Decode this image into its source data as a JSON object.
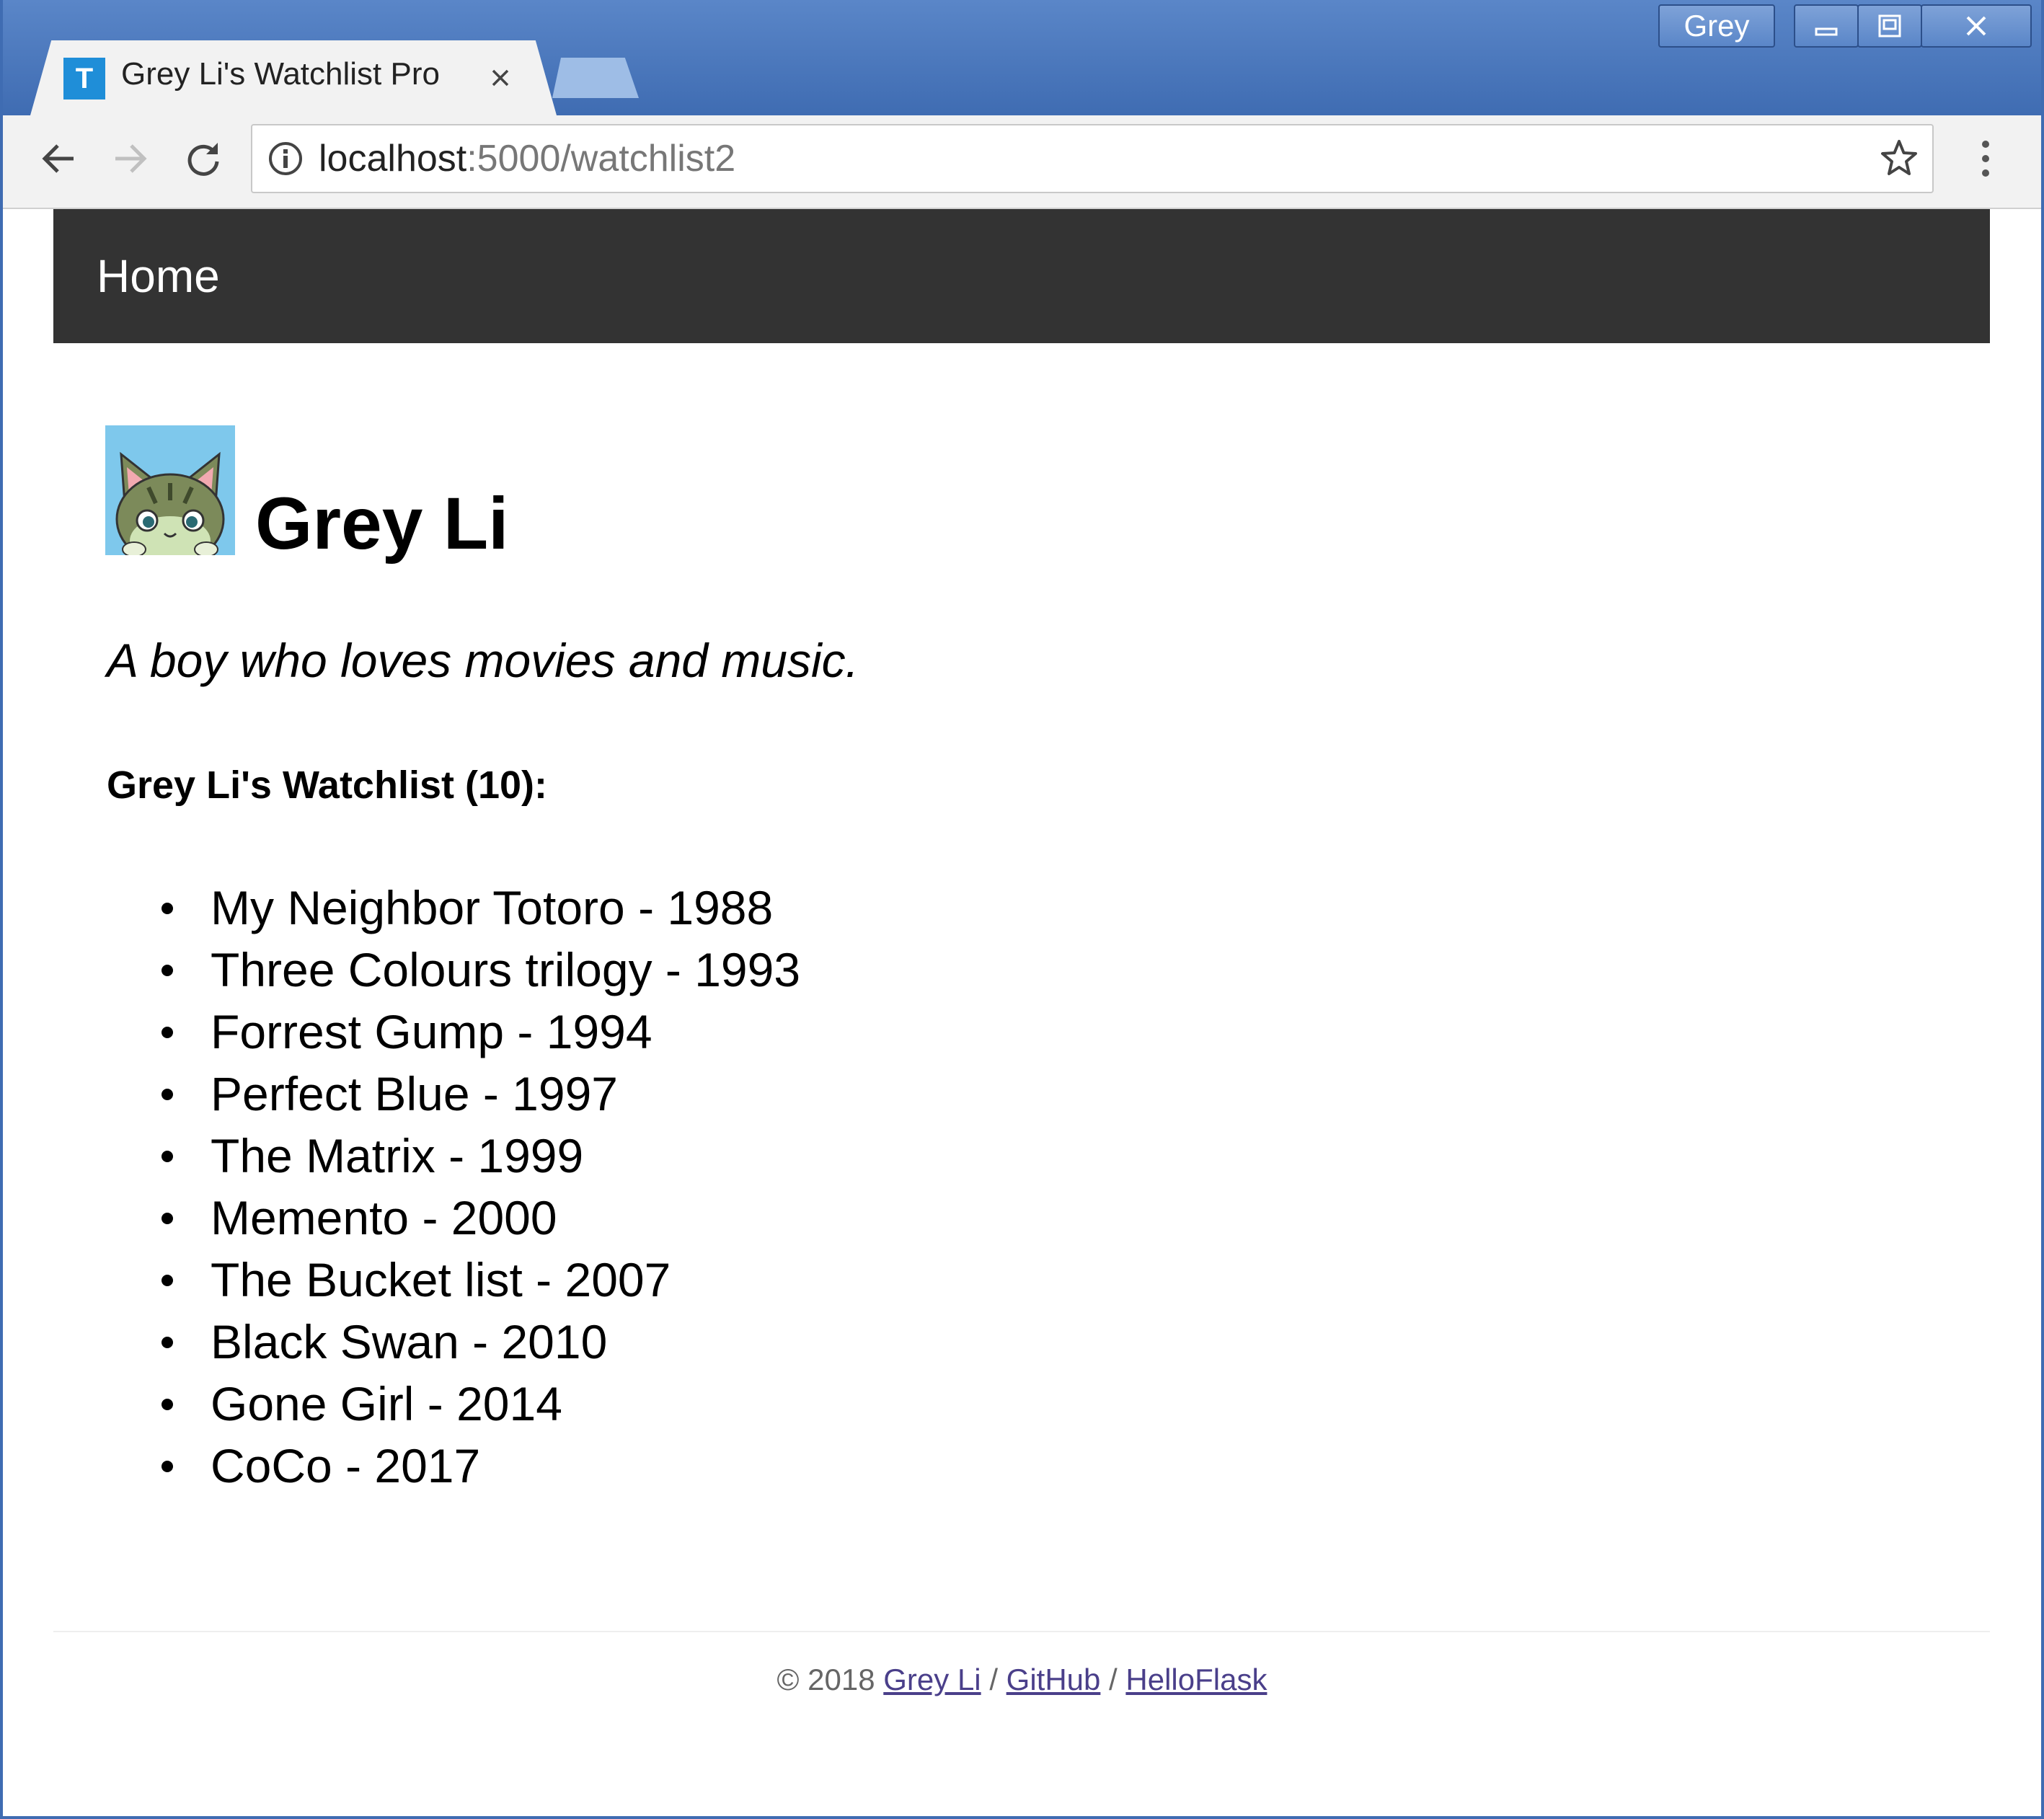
{
  "window": {
    "user_label": "Grey"
  },
  "browser": {
    "tab_title": "Grey Li's Watchlist Pro",
    "tab_favicon_letter": "T",
    "url_host": "localhost",
    "url_path": ":5000/watchlist2"
  },
  "navbar": {
    "home_label": "Home"
  },
  "profile": {
    "name": "Grey Li",
    "bio": "A boy who loves movies and music."
  },
  "watchlist": {
    "heading": "Grey Li's Watchlist (10):",
    "items": [
      "My Neighbor Totoro - 1988",
      "Three Colours trilogy - 1993",
      "Forrest Gump - 1994",
      "Perfect Blue - 1997",
      "The Matrix - 1999",
      "Memento - 2000",
      "The Bucket list - 2007",
      "Black Swan - 2010",
      "Gone Girl - 2014",
      "CoCo - 2017"
    ]
  },
  "footer": {
    "copyright": "© 2018",
    "sep": "/",
    "links": [
      "Grey Li",
      "GitHub",
      "HelloFlask"
    ]
  },
  "colors": {
    "titlebar": "#4a78bd",
    "navbar": "#333333",
    "footer_link": "#4a3f8a"
  },
  "icons": [
    "back-arrow-icon",
    "forward-arrow-icon",
    "reload-icon",
    "info-icon",
    "star-icon",
    "menu-dots-icon",
    "close-icon",
    "minimize-icon",
    "maximize-icon",
    "cat-avatar-icon"
  ]
}
